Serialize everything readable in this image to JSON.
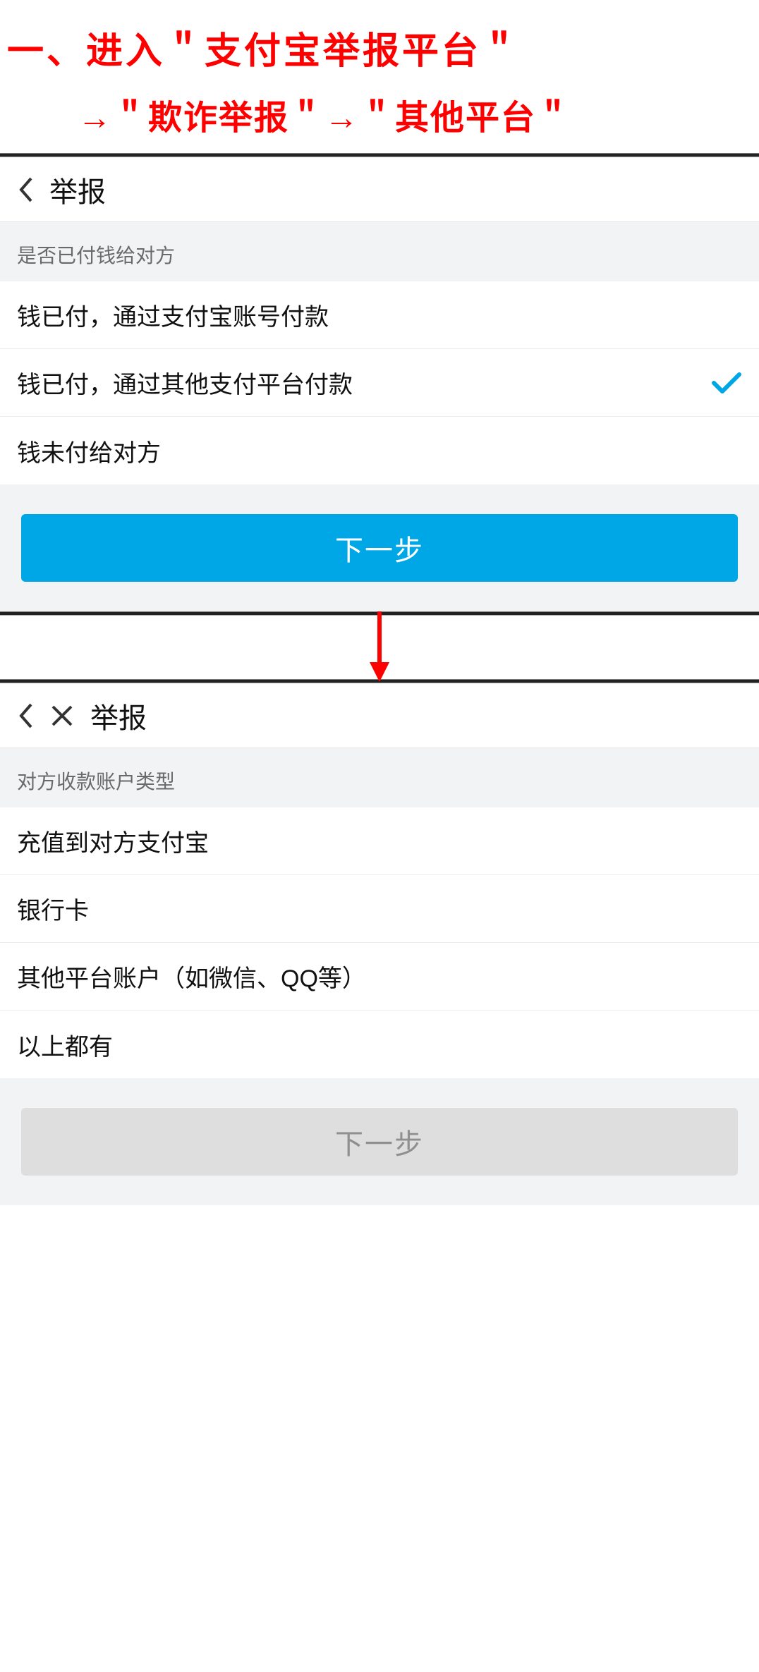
{
  "instructions": {
    "line1": "一、进入＂支付宝举报平台＂",
    "line2": "→＂欺诈举报＂→＂其他平台＂"
  },
  "screen1": {
    "title": "举报",
    "section_label": "是否已付钱给对方",
    "options": [
      {
        "label": "钱已付，通过支付宝账号付款",
        "selected": false
      },
      {
        "label": "钱已付，通过其他支付平台付款",
        "selected": true
      },
      {
        "label": "钱未付给对方",
        "selected": false
      }
    ],
    "button_label": "下一步"
  },
  "screen2": {
    "title": "举报",
    "section_label": "对方收款账户类型",
    "options": [
      {
        "label": "充值到对方支付宝"
      },
      {
        "label": "银行卡"
      },
      {
        "label": "其他平台账户（如微信、QQ等）"
      },
      {
        "label": "以上都有"
      }
    ],
    "button_label": "下一步"
  }
}
